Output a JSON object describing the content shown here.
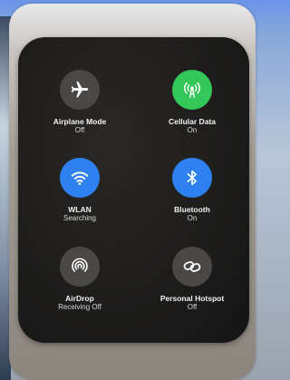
{
  "tiles": [
    {
      "label": "Airplane Mode",
      "status": "Off",
      "icon": "airplane-icon",
      "color": "#4a4846"
    },
    {
      "label": "Cellular Data",
      "status": "On",
      "icon": "antenna-icon",
      "color": "#34c759"
    },
    {
      "label": "WLAN",
      "status": "Searching",
      "icon": "wifi-icon",
      "color": "#2f80f0"
    },
    {
      "label": "Bluetooth",
      "status": "On",
      "icon": "bluetooth-icon",
      "color": "#2f80f0"
    },
    {
      "label": "AirDrop",
      "status": "Receiving Off",
      "icon": "airdrop-icon",
      "color": "#4a4846"
    },
    {
      "label": "Personal Hotspot",
      "status": "Off",
      "icon": "hotspot-link-icon",
      "color": "#4a4846"
    }
  ]
}
